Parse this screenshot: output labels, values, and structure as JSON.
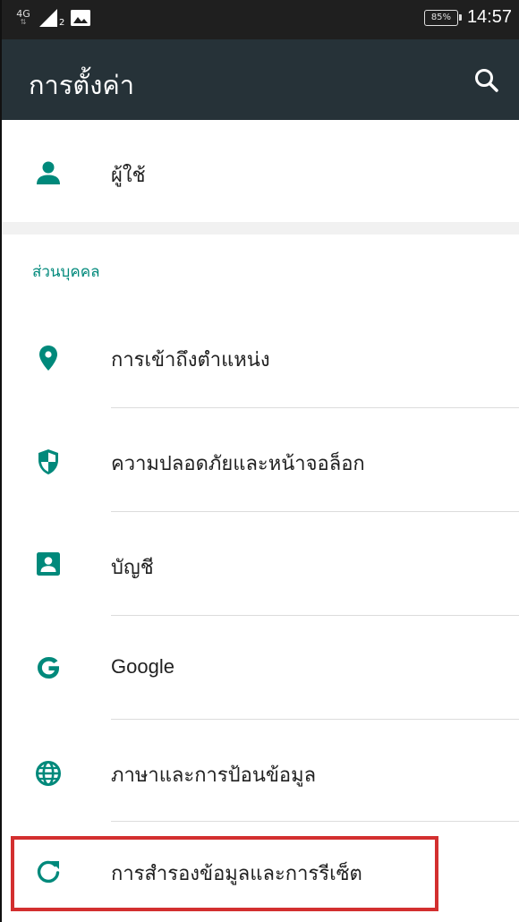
{
  "status_bar": {
    "network_type": "4G",
    "sim_slot": "2",
    "battery": "85%",
    "time": "14:57",
    "icons": [
      "signal-icon",
      "gallery-icon"
    ]
  },
  "toolbar": {
    "title": "การตั้งค่า",
    "search_icon": "search-icon"
  },
  "users": {
    "label": "ผู้ใช้",
    "icon": "person-icon"
  },
  "personal_section": {
    "header": "ส่วนบุคคล",
    "items": [
      {
        "label": "การเข้าถึงตำแหน่ง",
        "icon": "location-pin-icon"
      },
      {
        "label": "ความปลอดภัยและหน้าจอล็อก",
        "icon": "shield-icon"
      },
      {
        "label": "บัญชี",
        "icon": "account-box-icon"
      },
      {
        "label": "Google",
        "icon": "google-icon"
      },
      {
        "label": "ภาษาและการป้อนข้อมูล",
        "icon": "globe-icon"
      },
      {
        "label": "การสำรองข้อมูลและการรีเซ็ต",
        "icon": "backup-reset-icon"
      }
    ]
  },
  "colors": {
    "accent": "#00897b",
    "toolbar_bg": "#263238",
    "status_bar_bg": "#1f1f1f",
    "highlight": "#d32f2f"
  }
}
